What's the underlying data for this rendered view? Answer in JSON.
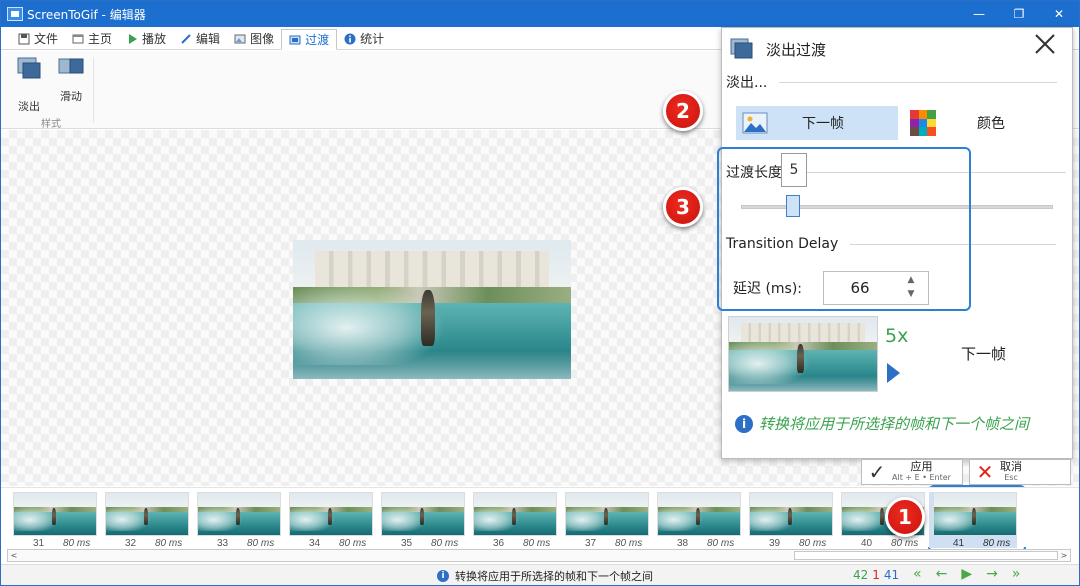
{
  "window": {
    "title": "ScreenToGif - 编辑器",
    "controls": [
      "—",
      "❐",
      "✕"
    ]
  },
  "menu": {
    "tabs": [
      {
        "label": "文件",
        "icon": "save-icon"
      },
      {
        "label": "主页",
        "icon": "home-icon"
      },
      {
        "label": "播放",
        "icon": "play-icon"
      },
      {
        "label": "编辑",
        "icon": "pencil-icon"
      },
      {
        "label": "图像",
        "icon": "image-icon"
      },
      {
        "label": "过渡",
        "icon": "transition-icon",
        "active": true
      },
      {
        "label": "统计",
        "icon": "info-icon"
      }
    ]
  },
  "ribbon": {
    "buttons": [
      {
        "label": "淡出",
        "icon": "fade-icon"
      },
      {
        "label": "滑动",
        "icon": "slide-icon"
      }
    ],
    "group_label": "样式"
  },
  "panel": {
    "title": "淡出过渡",
    "fade_section": "淡出...",
    "choice_next": "下一帧",
    "choice_color": "颜色",
    "length_label": "过渡长度",
    "length_value": "5",
    "slider_fraction": 0.15,
    "delay_section": "Transition Delay",
    "delay_label": "延迟 (ms):",
    "delay_value": "66",
    "preview_multiplier": "5x",
    "preview_target": "下一帧",
    "info_text": "转换将应用于所选择的帧和下一个帧之间"
  },
  "actions": {
    "apply": {
      "label": "应用",
      "shortcut": "Alt + E • Enter"
    },
    "cancel": {
      "label": "取消",
      "shortcut": "Esc"
    }
  },
  "badges": {
    "one": "1",
    "two": "2",
    "three": "3"
  },
  "frames": [
    {
      "number": "31",
      "delay": "80 ms"
    },
    {
      "number": "32",
      "delay": "80 ms"
    },
    {
      "number": "33",
      "delay": "80 ms"
    },
    {
      "number": "34",
      "delay": "80 ms"
    },
    {
      "number": "35",
      "delay": "80 ms"
    },
    {
      "number": "36",
      "delay": "80 ms"
    },
    {
      "number": "37",
      "delay": "80 ms"
    },
    {
      "number": "38",
      "delay": "80 ms"
    },
    {
      "number": "39",
      "delay": "80 ms"
    },
    {
      "number": "40",
      "delay": "80 ms"
    },
    {
      "number": "41",
      "delay": "80 ms",
      "selected": true
    }
  ],
  "status": {
    "message": "转换将应用于所选择的帧和下一个帧之间",
    "total_frames": "42",
    "selected_count": "1",
    "current_frame": "41"
  },
  "colors": {
    "accent": "#1d6fcf",
    "highlight": "#2e7fd6",
    "green": "#3aa24e",
    "badge_red": "#e0241b"
  }
}
